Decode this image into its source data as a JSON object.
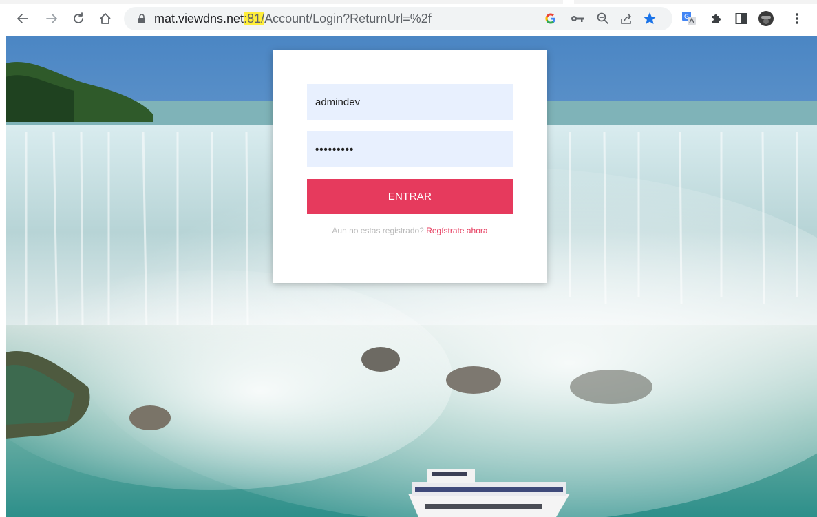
{
  "browser": {
    "url_host": "mat.viewdns.net",
    "url_port": ":81/",
    "url_path": "Account/Login?ReturnUrl=%2f",
    "icons": [
      "back-arrow-icon",
      "forward-arrow-icon",
      "reload-icon",
      "home-icon",
      "lock-icon",
      "google-g-icon",
      "key-icon",
      "zoom-icon",
      "share-icon",
      "bookmark-star-icon",
      "translate-extension-icon",
      "puzzle-extensions-icon",
      "side-panel-icon",
      "profile-avatar-icon",
      "kebab-menu-icon"
    ]
  },
  "login": {
    "username_value": "admindev",
    "password_value": "•••••••••",
    "submit_label": "ENTRAR",
    "register_prompt": "Aun no estas registrado?",
    "register_link": "Regístrate ahora"
  },
  "colors": {
    "accent": "#e63a5d",
    "autofill_bg": "#e8f0fe",
    "port_highlight": "#ffee3a",
    "bookmark_star": "#1a73e8"
  }
}
